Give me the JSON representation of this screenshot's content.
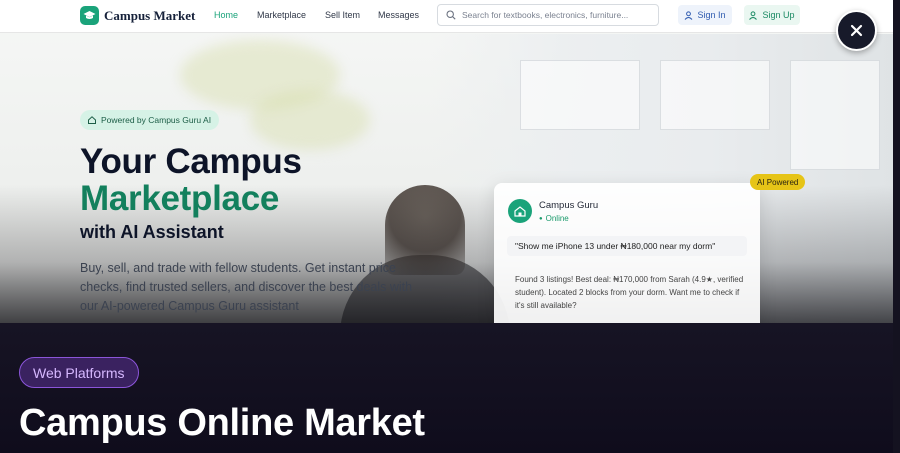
{
  "nav": {
    "brand": "Campus Market",
    "links": [
      "Home",
      "Marketplace",
      "Sell Item",
      "Messages"
    ],
    "active_link": "Home",
    "search_placeholder": "Search for textbooks, electronics, furniture...",
    "signin_label": "Sign In",
    "signup_label": "Sign Up"
  },
  "hero": {
    "pill": "Powered by Campus Guru AI",
    "title_line1": "Your Campus",
    "title_line2": "Marketplace",
    "title_line3": "with AI Assistant",
    "description": "Buy, sell, and trade with fellow students. Get instant price checks, find trusted sellers, and discover the best deals with our AI-powered Campus Guru assistant"
  },
  "chat_card": {
    "badge": "AI Powered",
    "assistant_name": "Campus Guru",
    "status": "Online",
    "query": "\"Show me iPhone 13 under ₦180,000 near my dorm\"",
    "answer": "Found 3 listings! Best deal: ₦170,000 from Sarah (4.9★, verified student). Located 2 blocks from your dorm. Want me to check if it's still available?"
  },
  "overlay": {
    "tag": "Web Platforms",
    "title": "Campus Online Market"
  },
  "colors": {
    "brand_green": "#1aa37a",
    "title_green": "#13805d",
    "overlay_bg": "#0f0c1c",
    "tag_purple": "#8b55d9",
    "ai_badge_yellow": "#e6c417"
  },
  "icons": {
    "close": "close-icon",
    "logo": "graduation-cap-icon",
    "search": "search-icon",
    "user": "user-icon",
    "home": "home-icon"
  }
}
